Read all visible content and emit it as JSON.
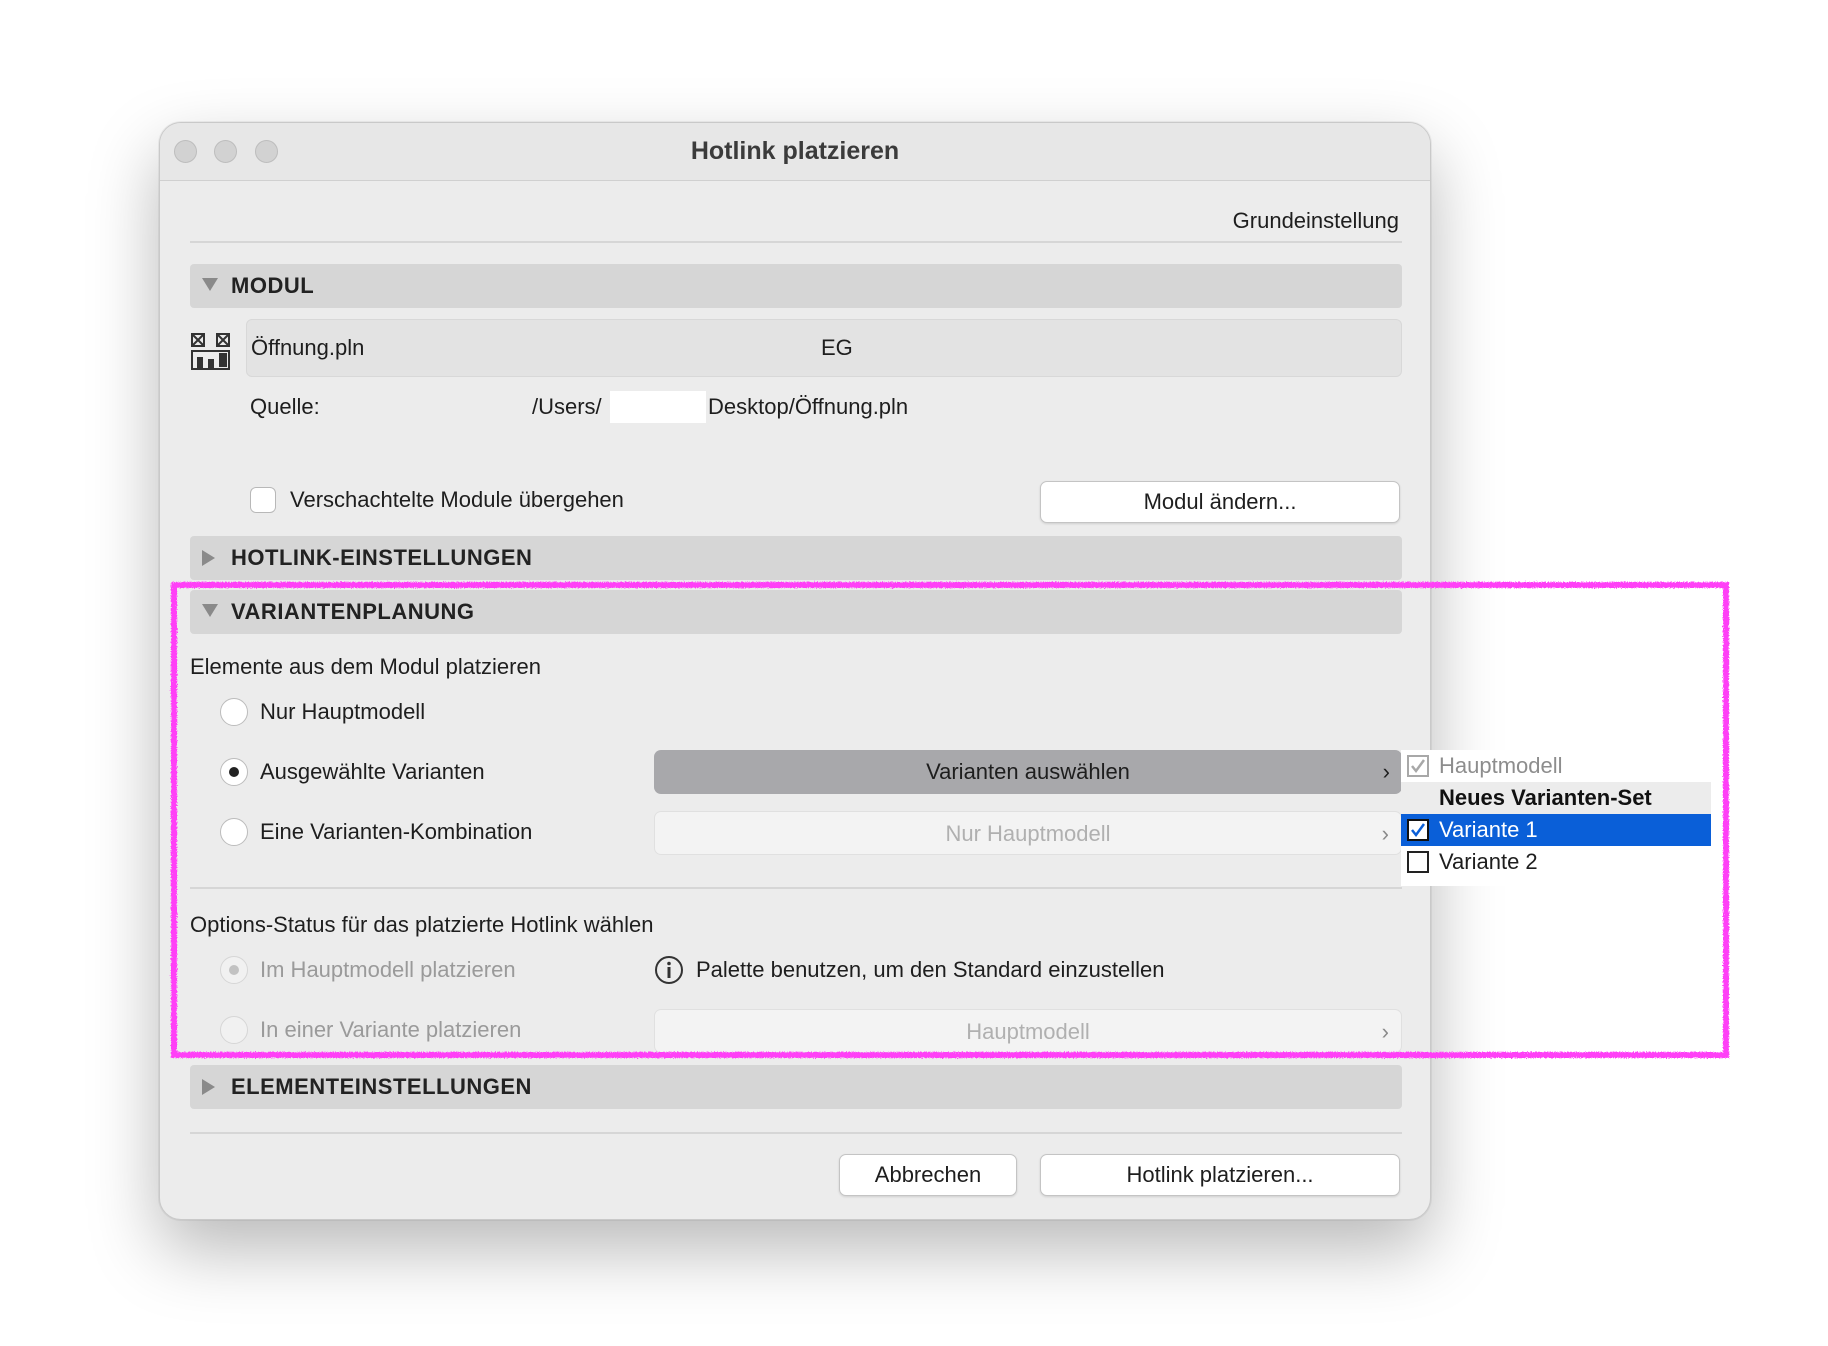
{
  "window": {
    "title": "Hotlink platzieren"
  },
  "toolbar": {
    "preset_label": "Grundeinstellung"
  },
  "modul": {
    "header": "MODUL",
    "file_name": "Öffnung.pln",
    "story": "EG",
    "source_label": "Quelle:",
    "source_path_start": "/Users/",
    "source_path_end": "Desktop/Öffnung.pln",
    "skip_nested_label": "Verschachtelte Module übergehen",
    "skip_nested_checked": false,
    "change_button": "Modul ändern..."
  },
  "hotlink_settings": {
    "header": "HOTLINK-EINSTELLUNGEN"
  },
  "variant_planning": {
    "header": "VARIANTENPLANUNG",
    "place_elements_label": "Elemente aus dem Modul platzieren",
    "options": [
      {
        "label": "Nur Hauptmodell",
        "selected": false
      },
      {
        "label": "Ausgewählte Varianten",
        "selected": true
      },
      {
        "label": "Eine Varianten-Kombination",
        "selected": false
      }
    ],
    "select_variants_button": "Varianten auswählen",
    "combination_popup": "Nur Hauptmodell",
    "option_status_label": "Options-Status für das platzierte Hotlink wählen",
    "status_options": [
      {
        "label": "Im Hauptmodell platzieren",
        "selected": true,
        "disabled": true
      },
      {
        "label": "In einer Variante platzieren",
        "selected": false,
        "disabled": true
      }
    ],
    "info_text": "Palette benutzen, um den Standard einzustellen",
    "variant_popup": "Hauptmodell"
  },
  "variants_menu": {
    "items": [
      {
        "label": "Hauptmodell",
        "checked": true,
        "disabled": true
      },
      {
        "label": "Neues Varianten-Set",
        "is_header": true
      },
      {
        "label": "Variante 1",
        "checked": true,
        "highlighted": true
      },
      {
        "label": "Variante 2",
        "checked": false
      }
    ]
  },
  "element_settings": {
    "header": "ELEMENTEINSTELLUNGEN"
  },
  "footer": {
    "cancel_button": "Abbrechen",
    "place_button": "Hotlink platzieren..."
  },
  "colors": {
    "highlight": "#ff3ff7",
    "menu_selection": "#0a5fd8",
    "window_bg": "#ececec",
    "section_bg": "#d6d6d6"
  }
}
